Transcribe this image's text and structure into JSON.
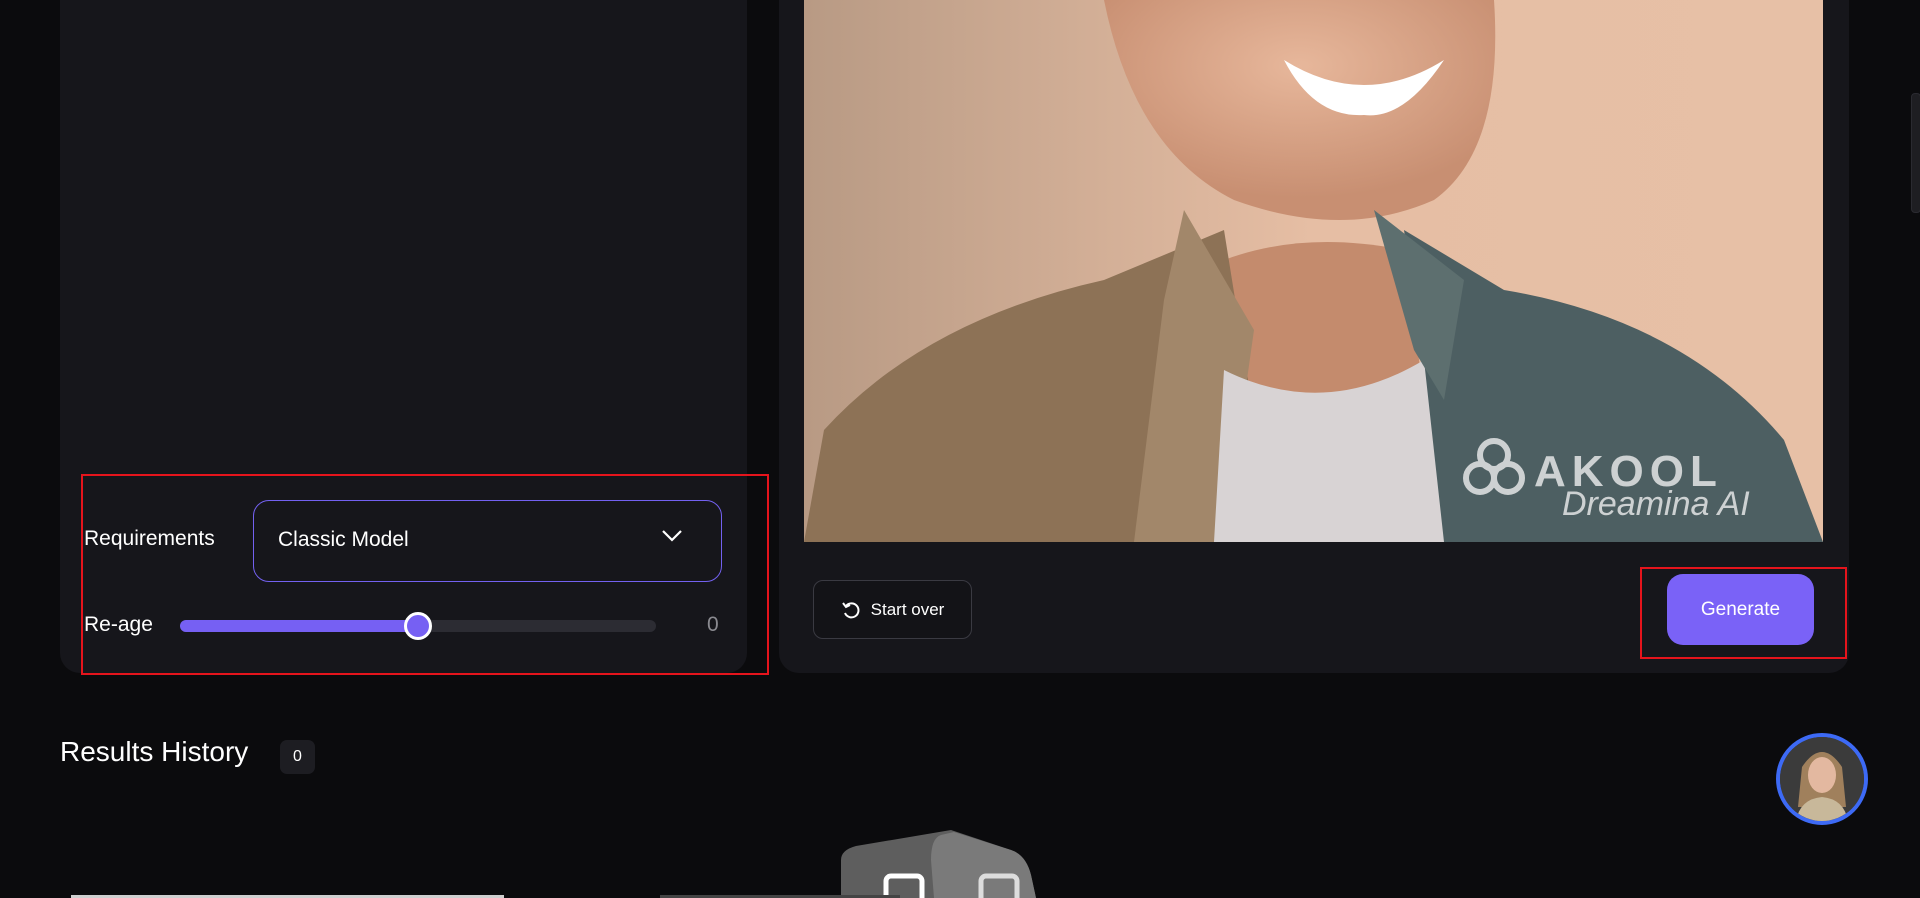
{
  "settings": {
    "requirements_label": "Requirements",
    "model_select_value": "Classic Model",
    "reage_label": "Re-age",
    "reage_value": "0",
    "reage_slider_fraction": 0.5
  },
  "preview": {
    "watermark_brand": "AKOOL",
    "watermark_sub": "Dreamina AI",
    "start_over_label": "Start over",
    "generate_label": "Generate"
  },
  "results": {
    "title": "Results History",
    "count": "0"
  },
  "colors": {
    "accent": "#7a62f7",
    "highlight": "#e5141c",
    "avatar_ring": "#3d6af5"
  }
}
